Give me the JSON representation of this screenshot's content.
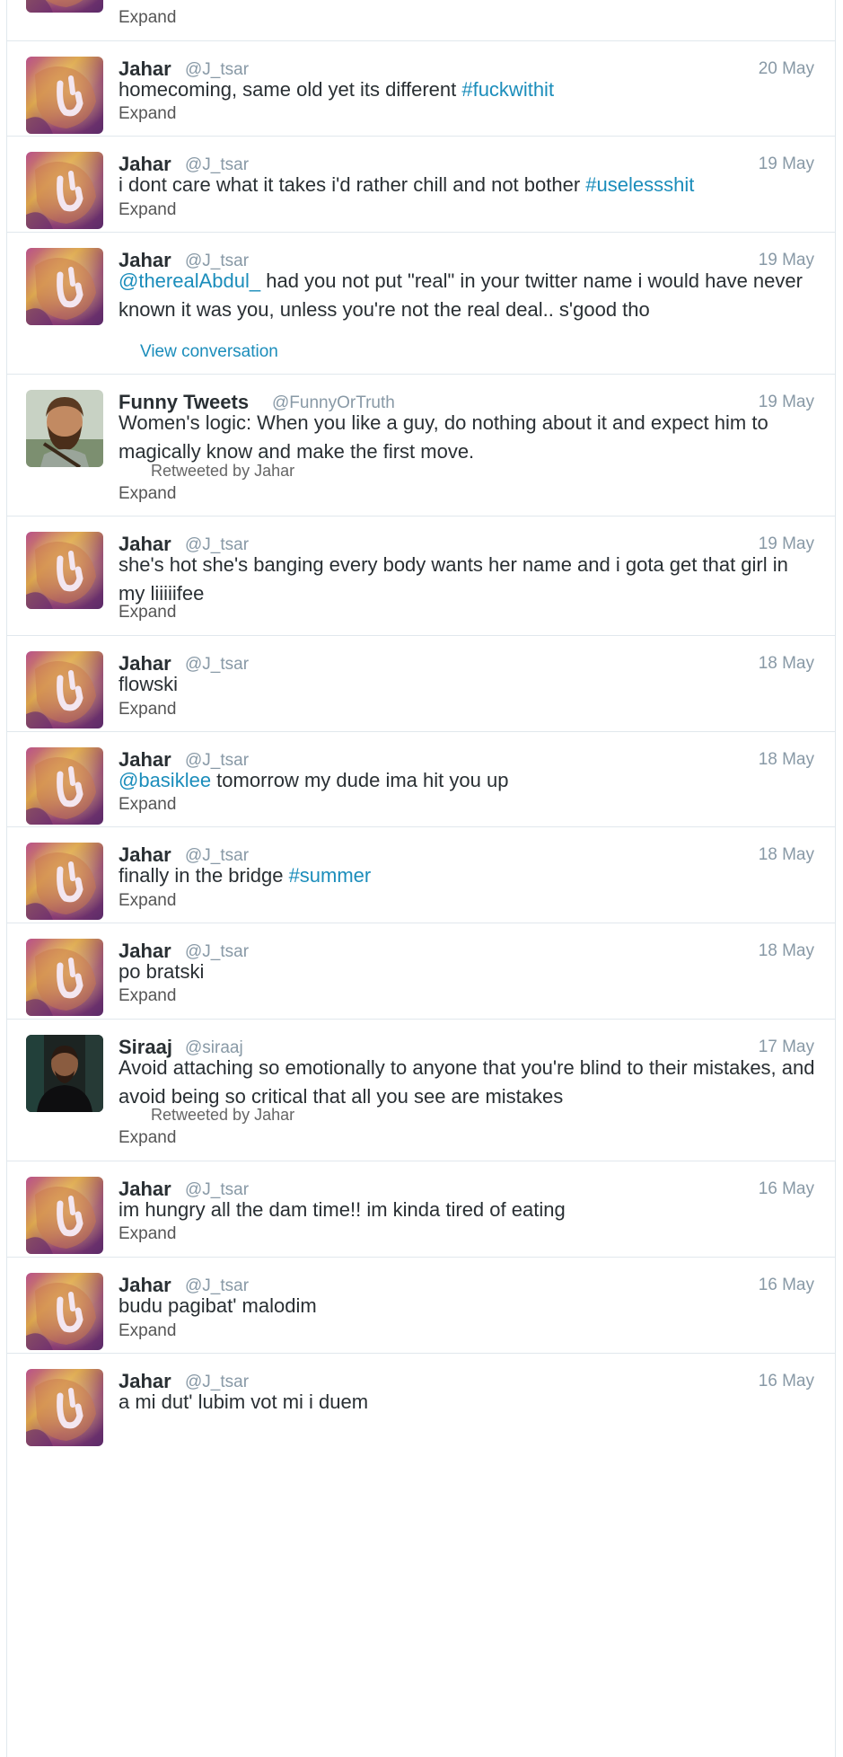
{
  "stream": {
    "partial_top": {
      "expand": "Expand"
    },
    "tweets": [
      {
        "name": "Jahar",
        "handle": "@J_tsar",
        "date": "20 May",
        "text": "homecoming, same old yet its different ",
        "hashtag": "#fuckwithit",
        "expand": "Expand"
      },
      {
        "name": "Jahar",
        "handle": "@J_tsar",
        "date": "19 May",
        "text": "i dont care what it takes i'd rather chill and not bother ",
        "hashtag": "#uselessshit",
        "expand": "Expand"
      },
      {
        "name": "Jahar",
        "handle": "@J_tsar",
        "date": "19 May",
        "mention": "@therealAbdul_",
        "text": " had you not put \"real\" in your twitter name i would have never known it was you, unless you're not the real deal.. s'good tho",
        "conversation": "View conversation"
      },
      {
        "name": "Funny Tweets",
        "handle": "@FunnyOrTruth",
        "date": "19 May",
        "text": "Women's logic: When you like a guy, do nothing about it and expect him to magically know and make the first move.",
        "retweeted": "Retweeted by Jahar",
        "expand": "Expand"
      },
      {
        "name": "Jahar",
        "handle": "@J_tsar",
        "date": "19 May",
        "text": "she's hot she's banging every body wants her name and i gota get that girl in my liiiiifee",
        "expand": "Expand"
      },
      {
        "name": "Jahar",
        "handle": "@J_tsar",
        "date": "18 May",
        "text": "flowski",
        "expand": "Expand"
      },
      {
        "name": "Jahar",
        "handle": "@J_tsar",
        "date": "18 May",
        "mention": "@basiklee",
        "text": " tomorrow my dude ima hit you up",
        "expand": "Expand"
      },
      {
        "name": "Jahar",
        "handle": "@J_tsar",
        "date": "18 May",
        "text": "finally in the bridge ",
        "hashtag": "#summer",
        "expand": "Expand"
      },
      {
        "name": "Jahar",
        "handle": "@J_tsar",
        "date": "18 May",
        "text": "po bratski",
        "expand": "Expand"
      },
      {
        "name": "Siraaj",
        "handle": "@siraaj",
        "date": "17 May",
        "text": "Avoid attaching so emotionally to anyone that you're blind to their mistakes, and avoid being so critical that all you see are mistakes",
        "retweeted": "Retweeted by Jahar",
        "expand": "Expand"
      },
      {
        "name": "Jahar",
        "handle": "@J_tsar",
        "date": "16 May",
        "text": "im hungry all the dam time!! im kinda tired of eating",
        "expand": "Expand"
      },
      {
        "name": "Jahar",
        "handle": "@J_tsar",
        "date": "16 May",
        "text": "budu pagibat' malodim",
        "expand": "Expand"
      },
      {
        "name": "Jahar",
        "handle": "@J_tsar",
        "date": "16 May",
        "text": "a mi dut' lubim vot mi i duem"
      }
    ]
  },
  "colors": {
    "link": "#1b8dbb",
    "meta": "#8899a6",
    "text": "#292f33",
    "border": "#e1e8ed"
  },
  "icons": {
    "jahar_avatar": "lion-avatar-icon",
    "funny_avatar": "bearded-man-avatar-icon",
    "siraaj_avatar": "man-portrait-avatar-icon"
  }
}
